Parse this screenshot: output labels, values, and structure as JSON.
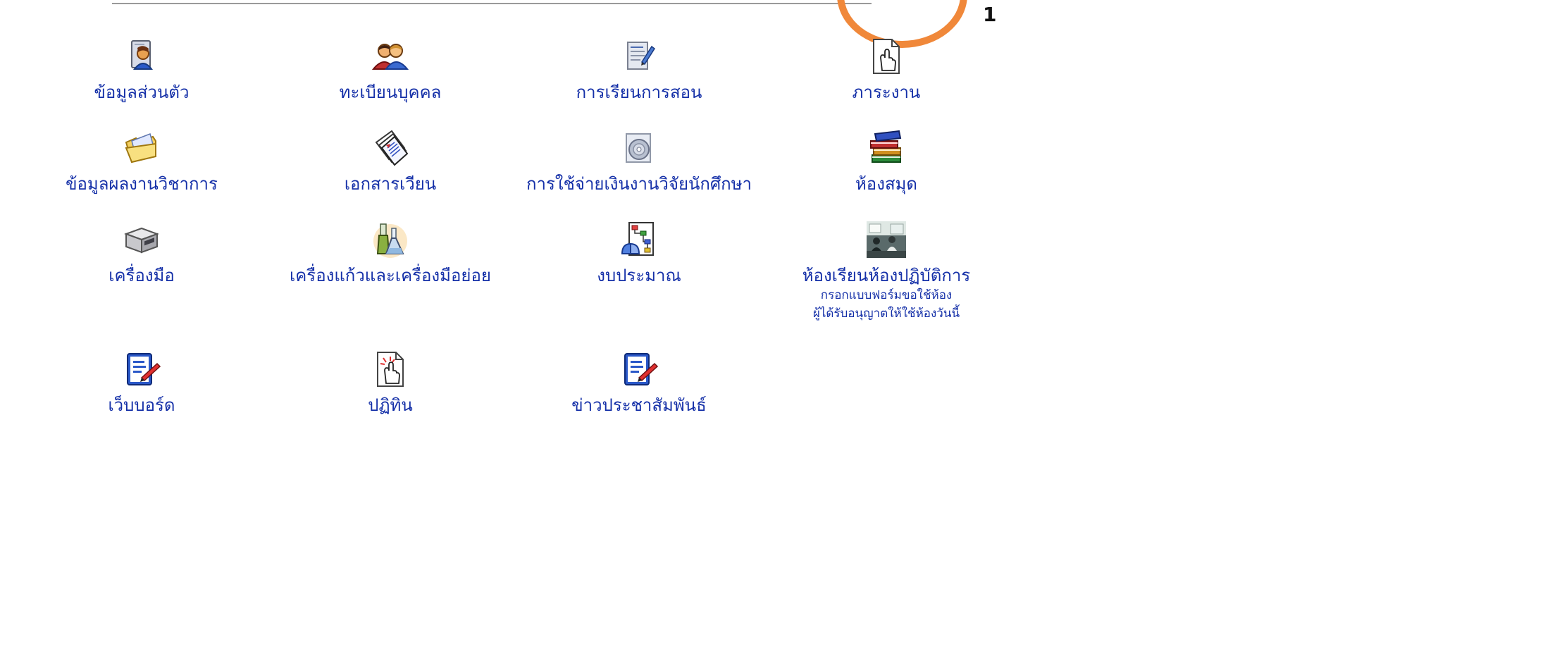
{
  "callout": {
    "number": "1"
  },
  "menu": {
    "items": [
      {
        "label": "ข้อมูลส่วนตัว",
        "icon": "person-card-icon"
      },
      {
        "label": "ทะเบียนบุคคล",
        "icon": "users-icon"
      },
      {
        "label": "การเรียนการสอน",
        "icon": "document-edit-icon"
      },
      {
        "label": "ภาระงาน",
        "icon": "hand-document-icon"
      },
      {
        "label": "ข้อมูลผลงานวิชาการ",
        "icon": "open-folder-icon"
      },
      {
        "label": "เอกสารเวียน",
        "icon": "stacked-papers-icon"
      },
      {
        "label": "การใช้จ่ายเงินงานวิจัยนักศึกษา",
        "icon": "disc-icon"
      },
      {
        "label": "ห้องสมุด",
        "icon": "books-icon"
      },
      {
        "label": "เครื่องมือ",
        "icon": "device-box-icon"
      },
      {
        "label": "เครื่องแก้วและเครื่องมือย่อย",
        "icon": "glassware-icon"
      },
      {
        "label": "งบประมาณ",
        "icon": "flowchart-icon"
      },
      {
        "label": "ห้องเรียนห้องปฏิบัติการ",
        "icon": "classroom-photo-icon",
        "sub_links": [
          "กรอกแบบฟอร์มขอใช้ห้อง",
          "ผู้ได้รับอนุญาตให้ใช้ห้องวันนี้"
        ]
      },
      {
        "label": "เว็บบอร์ด",
        "icon": "notepad-pen-icon"
      },
      {
        "label": "ปฏิทิน",
        "icon": "click-document-icon"
      },
      {
        "label": "ข่าวประชาสัมพันธ์",
        "icon": "notepad-pen-icon"
      }
    ]
  }
}
